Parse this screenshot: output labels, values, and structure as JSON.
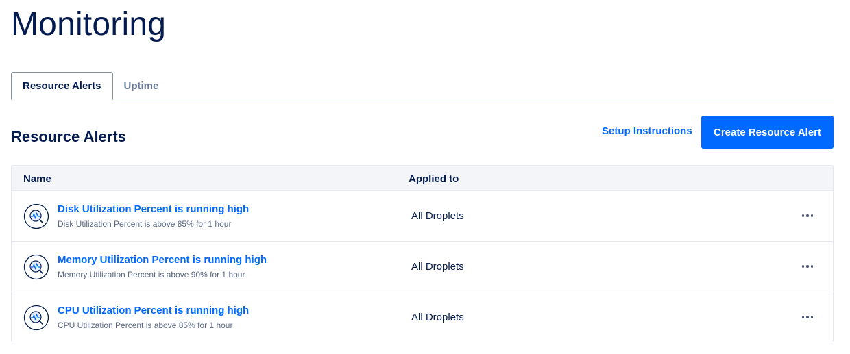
{
  "page": {
    "title": "Monitoring"
  },
  "tabs": [
    {
      "label": "Resource Alerts",
      "active": true
    },
    {
      "label": "Uptime",
      "active": false
    }
  ],
  "section": {
    "title": "Resource Alerts",
    "setup_link": "Setup Instructions",
    "create_button": "Create Resource Alert"
  },
  "table": {
    "columns": {
      "name": "Name",
      "applied_to": "Applied to"
    },
    "rows": [
      {
        "icon": "monitor-graph-icon",
        "title": "Disk Utilization Percent is running high",
        "description": "Disk Utilization Percent is above 85% for 1 hour",
        "applied_to": "All Droplets"
      },
      {
        "icon": "monitor-graph-icon",
        "title": "Memory Utilization Percent is running high",
        "description": "Memory Utilization Percent is above 90% for 1 hour",
        "applied_to": "All Droplets"
      },
      {
        "icon": "monitor-graph-icon",
        "title": "CPU Utilization Percent is running high",
        "description": "CPU Utilization Percent is above 85% for 1 hour",
        "applied_to": "All Droplets"
      }
    ]
  },
  "colors": {
    "accent": "#0069ff",
    "text": "#031b4e",
    "muted": "#5b6987"
  }
}
